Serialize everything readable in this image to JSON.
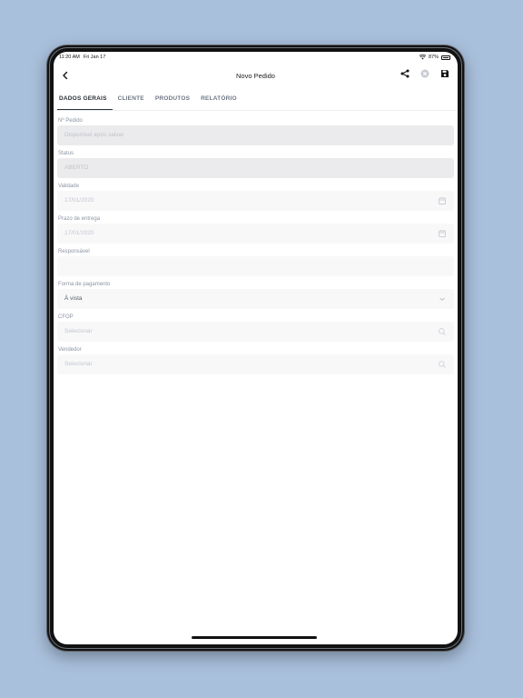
{
  "status_bar": {
    "time": "11:20 AM",
    "date": "Fri Jan 17",
    "battery": "87%"
  },
  "header": {
    "title": "Novo Pedido"
  },
  "tabs": [
    {
      "label": "DADOS GERAIS",
      "active": true
    },
    {
      "label": "CLIENTE",
      "active": false
    },
    {
      "label": "PRODUTOS",
      "active": false
    },
    {
      "label": "RELATÓRIO",
      "active": false
    }
  ],
  "form": {
    "pedido": {
      "label": "Nº Pedido",
      "placeholder": "Disponível após salvar"
    },
    "status": {
      "label": "Status",
      "value": "ABERTO"
    },
    "validade": {
      "label": "Validade",
      "value": "17/01/2020"
    },
    "prazo": {
      "label": "Prazo de entrega",
      "value": "17/01/2020"
    },
    "responsavel": {
      "label": "Responsável",
      "value": ""
    },
    "pagamento": {
      "label": "Forma de pagamento",
      "value": "À vista"
    },
    "cfop": {
      "label": "CFOP",
      "placeholder": "Selecionar"
    },
    "vendedor": {
      "label": "Vendedor",
      "placeholder": "Selecionar"
    }
  },
  "colors": {
    "background": "#a9c0dc",
    "accent": "#2a2f37",
    "label": "#8c96a3"
  },
  "icons": [
    "back-icon",
    "share-icon",
    "close-circle-icon",
    "save-icon",
    "calendar-icon",
    "chevron-down-icon",
    "search-icon",
    "wifi-icon",
    "battery-icon"
  ]
}
